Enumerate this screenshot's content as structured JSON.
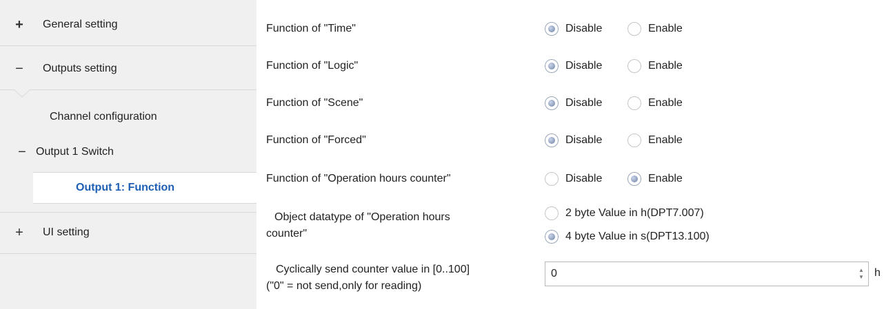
{
  "sidebar": {
    "items": [
      {
        "sign": "+",
        "label": "General setting"
      },
      {
        "sign": "−",
        "label": "Outputs setting"
      },
      {
        "sign": "",
        "label": "Channel configuration"
      },
      {
        "sign": "−",
        "label": "Output 1 Switch"
      },
      {
        "sign": "",
        "label": "Output 1: Function"
      },
      {
        "sign": "+",
        "label": "UI setting"
      }
    ]
  },
  "main": {
    "rows": [
      {
        "label": "Function of \"Time\"",
        "options": [
          "Disable",
          "Enable"
        ],
        "selected": "Disable"
      },
      {
        "label": "Function of \"Logic\"",
        "options": [
          "Disable",
          "Enable"
        ],
        "selected": "Disable"
      },
      {
        "label": "Function of \"Scene\"",
        "options": [
          "Disable",
          "Enable"
        ],
        "selected": "Disable"
      },
      {
        "label": "Function of \"Forced\"",
        "options": [
          "Disable",
          "Enable"
        ],
        "selected": "Disable"
      },
      {
        "label": "Function of \"Operation hours counter\"",
        "options": [
          "Disable",
          "Enable"
        ],
        "selected": "Enable"
      }
    ],
    "datatype": {
      "label_line1": "Object datatype of \"Operation hours",
      "label_line2": "counter\"",
      "options": [
        "2 byte Value in h(DPT7.007)",
        "4 byte Value in s(DPT13.100)"
      ],
      "selected": "4 byte Value in s(DPT13.100)"
    },
    "cyclic": {
      "label_line1": "Cyclically send counter value in [0..100]",
      "label_line2": "(\"0\" = not send,only for reading)",
      "value": "0",
      "unit": "h",
      "spin_up": "▲",
      "spin_down": "▼"
    }
  }
}
